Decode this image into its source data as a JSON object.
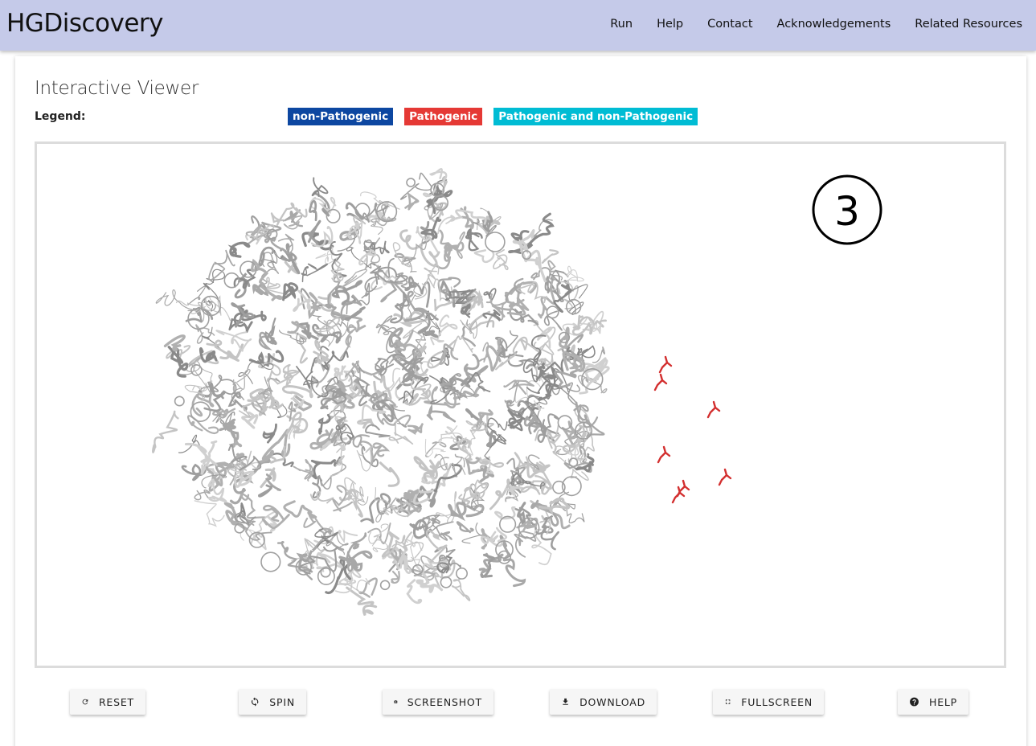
{
  "app": {
    "brand": "HGDiscovery"
  },
  "nav": {
    "items": [
      "Run",
      "Help",
      "Contact",
      "Acknowledgements",
      "Related Resources"
    ]
  },
  "page": {
    "title": "Interactive Viewer",
    "legend_label": "Legend:",
    "legend": [
      {
        "label": "non-Pathogenic",
        "color": "#0d47a1"
      },
      {
        "label": "Pathogenic",
        "color": "#e53935"
      },
      {
        "label": "Pathogenic and non-Pathogenic",
        "color": "#00bcd4"
      }
    ]
  },
  "viewer": {
    "marker": "3",
    "structure_color": "#bdbdbd",
    "highlight_color": "#d32f2f"
  },
  "controls": {
    "reset": "RESET",
    "spin": "SPIN",
    "screenshot": "SCREENSHOT",
    "download": "DOWNLOAD",
    "fullscreen": "FULLSCREEN",
    "help": "HELP"
  }
}
